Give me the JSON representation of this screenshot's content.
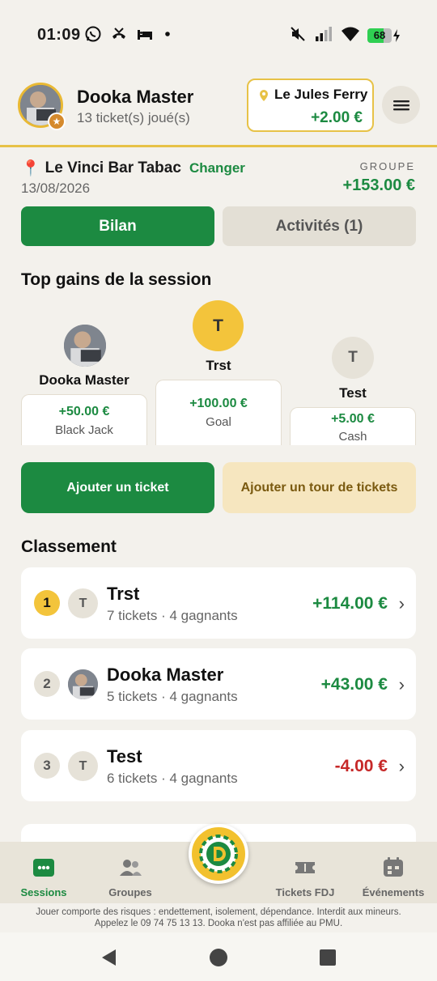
{
  "status_bar": {
    "time": "01:09",
    "battery": "68",
    "battery_level": 0.68
  },
  "header": {
    "user_name": "Dooka Master",
    "user_subtitle": "13 ticket(s) joué(s)",
    "venue_name": "Le Jules Ferry",
    "venue_amount": "+2.00 €"
  },
  "location": {
    "pin": "📍",
    "name": "Le Vinci Bar Tabac",
    "change_label": "Changer",
    "date": "13/08/2026",
    "group_label": "GROUPE",
    "group_amount": "+153.00 €"
  },
  "tabs": [
    {
      "label": "Bilan",
      "active": true
    },
    {
      "label": "Activités (1)",
      "active": false
    }
  ],
  "top_gains": {
    "title": "Top gains de la session",
    "players": [
      {
        "name": "Dooka Master",
        "initial": "",
        "amount": "+50.00 €",
        "game": "Black Jack"
      },
      {
        "name": "Trst",
        "initial": "T",
        "amount": "+100.00 €",
        "game": "Goal"
      },
      {
        "name": "Test",
        "initial": "T",
        "amount": "+5.00 €",
        "game": "Cash"
      }
    ]
  },
  "actions": {
    "add_ticket": "Ajouter un ticket",
    "add_tour": "Ajouter un tour de tickets"
  },
  "ranking": {
    "title": "Classement",
    "rows": [
      {
        "rank": "1",
        "initial": "T",
        "name": "Trst",
        "subtitle": "7 tickets · 4 gagnants",
        "amount": "+114.00 €",
        "color": "#1c8a41"
      },
      {
        "rank": "2",
        "initial": "",
        "name": "Dooka Master",
        "subtitle": "5 tickets · 4 gagnants",
        "amount": "+43.00 €",
        "color": "#1c8a41"
      },
      {
        "rank": "3",
        "initial": "T",
        "name": "Test",
        "subtitle": "6 tickets · 4 gagnants",
        "amount": "-4.00 €",
        "color": "#c62828"
      }
    ]
  },
  "bottom_nav": [
    {
      "label": "Sessions",
      "icon": "sessions-icon",
      "active": true
    },
    {
      "label": "Groupes",
      "icon": "groups-icon",
      "active": false
    },
    {
      "label": "Tickets FDJ",
      "icon": "ticket-icon",
      "active": false
    },
    {
      "label": "Événements",
      "icon": "calendar-icon",
      "active": false
    }
  ],
  "disclaimer": {
    "line1": "Jouer comporte des risques : endettement, isolement, dépendance. Interdit aux mineurs.",
    "line2": "Appelez le 09 74 75 13 13. Dooka n'est pas affiliée au PMU."
  },
  "colors": {
    "primary": "#1c8a41",
    "accent": "#e7c247",
    "negative": "#c62828"
  }
}
